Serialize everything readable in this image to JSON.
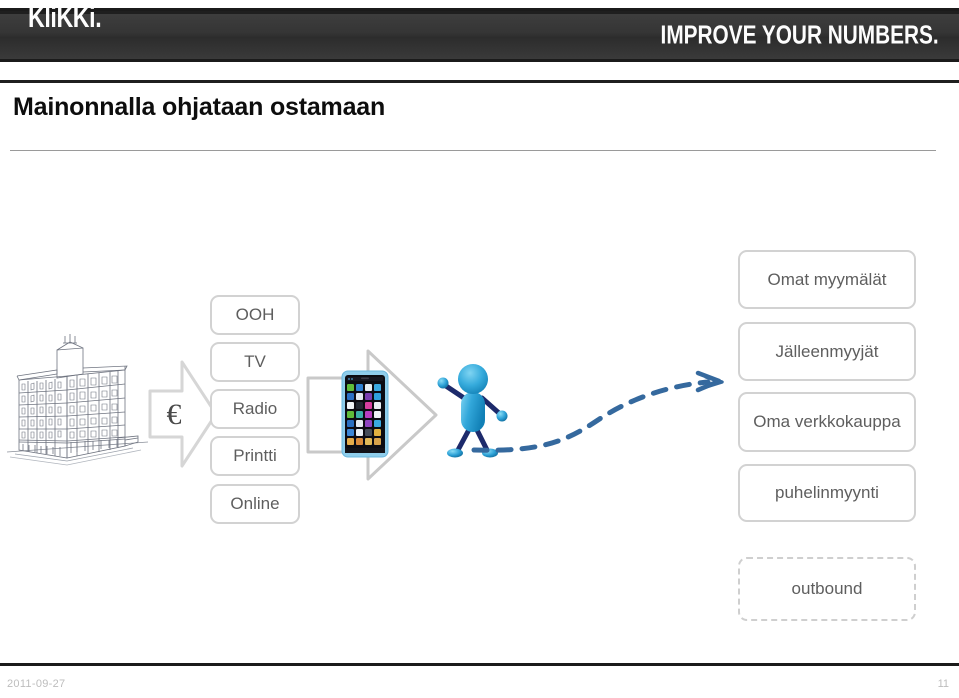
{
  "brand": {
    "logo": "KliKKi.",
    "tagline": "IMPROVE YOUR NUMBERS."
  },
  "slide": {
    "title": "Mainonnalla ohjataan ostamaan"
  },
  "media_channels": {
    "euro_symbol": "€",
    "items": [
      {
        "label": "OOH"
      },
      {
        "label": "TV"
      },
      {
        "label": "Radio"
      },
      {
        "label": "Printti"
      },
      {
        "label": "Online"
      }
    ]
  },
  "sales_channels": {
    "items": [
      {
        "label": "Omat myymälät"
      },
      {
        "label": "Jälleenmyyjät"
      },
      {
        "label": "Oma verkkokauppa"
      },
      {
        "label": "puhelinmyynti"
      }
    ],
    "outbound": {
      "label": "outbound"
    }
  },
  "footer": {
    "date": "2011-09-27",
    "page": "11"
  },
  "colors": {
    "bar_dark": "#353535",
    "box_border": "#d2d2d2",
    "box_text": "#5e5e5e",
    "arrow_gray": "#c9c9c9",
    "figure_blue": "#2fa5d8",
    "figure_navy": "#1d2a6b",
    "dash_blue": "#35699e",
    "footer_text": "#bdbdbd"
  }
}
